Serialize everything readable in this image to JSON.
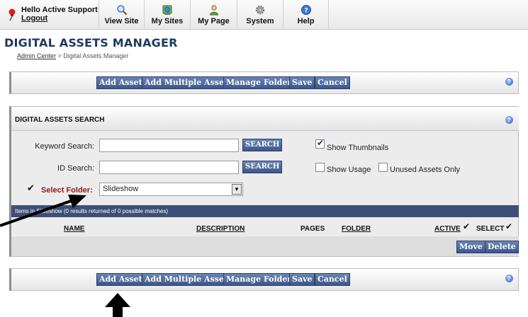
{
  "topbar": {
    "hello": "Hello Active Support",
    "logout": "Logout",
    "nav": [
      {
        "label": "View Site",
        "icon": "magnifier-icon"
      },
      {
        "label": "My Sites",
        "icon": "sites-icon"
      },
      {
        "label": "My Page",
        "icon": "user-icon"
      },
      {
        "label": "System",
        "icon": "gear-icon"
      },
      {
        "label": "Help",
        "icon": "help-icon"
      }
    ]
  },
  "page": {
    "title": "DIGITAL ASSETS MANAGER",
    "breadcrumb": {
      "link": "Admin Center",
      "separator": " > ",
      "current": "Digital Assets Manager"
    }
  },
  "toolbar": {
    "add_asset": "Add Asset",
    "add_multiple": "Add Multiple Assets",
    "manage_folders": "Manage Folders",
    "save": "Save",
    "cancel": "Cancel"
  },
  "search": {
    "title": "DIGITAL ASSETS SEARCH",
    "keyword_label": "Keyword Search:",
    "keyword_value": "",
    "id_label": "ID Search:",
    "id_value": "",
    "search_button": "SEARCH",
    "show_thumbnails": {
      "label": "Show Thumbnails",
      "checked": true
    },
    "show_usage": {
      "label": "Show Usage",
      "checked": false
    },
    "unused_only": {
      "label": "Unused Assets Only",
      "checked": false
    },
    "folder_label": "Select Folder:",
    "folder_value": "Slideshow"
  },
  "results": {
    "summary": "Items in Slideshow (0 results returned of 0 possible matches)",
    "columns": {
      "name": "NAME",
      "description": "DESCRIPTION",
      "pages": "PAGES",
      "folder": "FOLDER",
      "active": "ACTIVE",
      "select": "SELECT"
    },
    "move": "Move",
    "delete": "Delete"
  },
  "colors": {
    "title": "#1f3a5f",
    "button": "#3c568a",
    "results_bar": "#3d4f77",
    "folder_label": "#8b1a1a"
  }
}
